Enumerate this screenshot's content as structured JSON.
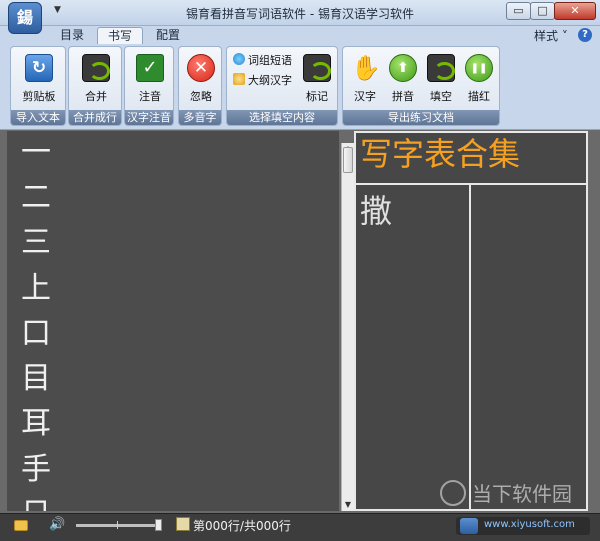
{
  "window": {
    "title": "锡育看拼音写词语软件 - 锡育汉语学习软件",
    "app_icon": "鍚",
    "controls": {
      "minimize": "▭",
      "maximize": "□",
      "close": "✕"
    }
  },
  "tabs": [
    {
      "label": "目录"
    },
    {
      "label": "书写"
    },
    {
      "label": "配置"
    }
  ],
  "tab_active": "书写",
  "style_menu": "样式 ˅",
  "help": "?",
  "ribbon": {
    "groups": [
      {
        "label": "导入文本",
        "buttons": [
          {
            "label": "剪贴板",
            "icon": "clipboard-icon",
            "glyph": "↻"
          }
        ]
      },
      {
        "label": "合并成行",
        "buttons": [
          {
            "label": "合并",
            "icon": "merge-icon",
            "glyph": ""
          }
        ]
      },
      {
        "label": "汉字注音",
        "buttons": [
          {
            "label": "注音",
            "icon": "annotate-icon",
            "glyph": "✓"
          }
        ]
      },
      {
        "label": "多音字",
        "buttons": [
          {
            "label": "忽略",
            "icon": "ignore-icon",
            "glyph": "✕"
          }
        ]
      },
      {
        "label": "选择填空内容",
        "small_buttons": [
          {
            "label": "词组短语"
          },
          {
            "label": "大纲汉字"
          }
        ],
        "buttons": [
          {
            "label": "标记",
            "icon": "mark-icon",
            "glyph": ""
          }
        ]
      },
      {
        "label": "导出练习文档",
        "buttons": [
          {
            "label": "汉字",
            "icon": "hand-icon",
            "glyph": "✋"
          },
          {
            "label": "拼音",
            "icon": "pinyin-icon",
            "glyph": "⬆"
          },
          {
            "label": "填空",
            "icon": "fill-icon",
            "glyph": ""
          },
          {
            "label": "描红",
            "icon": "trace-icon",
            "glyph": "❚❚"
          }
        ]
      }
    ]
  },
  "characters": [
    "一",
    "二",
    "三",
    "上",
    "口",
    "目",
    "耳",
    "手",
    "日"
  ],
  "sheet": {
    "title": "写字表合集",
    "first_char": "撒"
  },
  "scrollbar": {
    "up": "▲",
    "down": "▼"
  },
  "status": {
    "row_text": "第000行/共000行",
    "site": "www.xiyusoft.com",
    "speaker": "🔊"
  },
  "watermark": "当下软件园"
}
